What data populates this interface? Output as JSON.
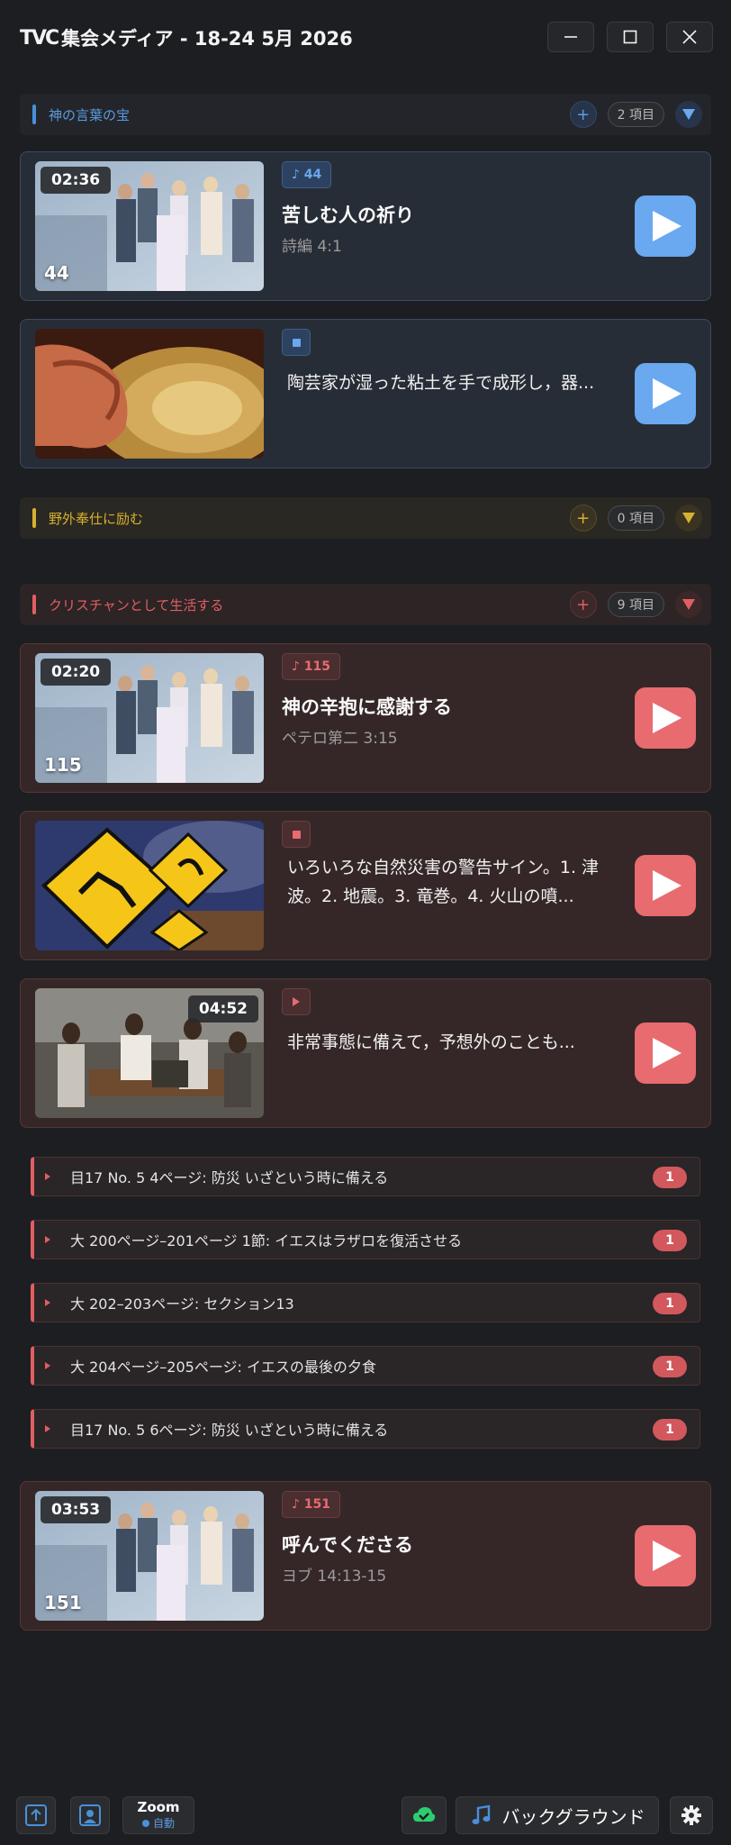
{
  "window": {
    "logo": "TVC",
    "title": "集会メディア - 18-24 5月 2026"
  },
  "sections": {
    "treasures": {
      "label": "神の言葉の宝",
      "add": "+",
      "count": "2 項目",
      "color": "#4a90d9"
    },
    "ministry": {
      "label": "野外奉仕に励む",
      "add": "+",
      "count": "0 項目",
      "color": "#d8b12e"
    },
    "living": {
      "label": "クリスチャンとして生活する",
      "add": "+",
      "count": "9 項目",
      "color": "#e15e64"
    }
  },
  "cards": [
    {
      "kind": "song",
      "duration": "02:36",
      "number": "44",
      "badge": "♪ 44",
      "title": "苦しむ人の祈り",
      "subtitle": "詩編 4:1"
    },
    {
      "kind": "image",
      "description": "陶芸家が湿った粘土を手で成形し，器..."
    },
    {
      "kind": "song",
      "duration": "02:20",
      "number": "115",
      "badge": "♪ 115",
      "title": "神の辛抱に感謝する",
      "subtitle": "ペテロ第二 3:15"
    },
    {
      "kind": "image",
      "description": "いろいろな自然災害の警告サイン。1. 津波。2. 地震。3. 竜巻。4. 火山の噴..."
    },
    {
      "kind": "video",
      "duration": "04:52",
      "description": "非常事態に備えて，予想外のことも..."
    },
    {
      "kind": "song",
      "duration": "03:53",
      "number": "151",
      "badge": "♪ 151",
      "title": "呼んでくださる",
      "subtitle": "ヨブ 14:13-15"
    }
  ],
  "references": [
    {
      "label": "目17 No. 5 4ページ: 防災 いざという時に備える",
      "count": "1"
    },
    {
      "label": "大 200ページ–201ページ 1節: イエスはラザロを復活させる",
      "count": "1"
    },
    {
      "label": "大 202–203ページ: セクション13",
      "count": "1"
    },
    {
      "label": "大 204ページ–205ページ: イエスの最後の夕食",
      "count": "1"
    },
    {
      "label": "目17 No. 5 6ページ: 防災 いざという時に備える",
      "count": "1"
    }
  ],
  "bottombar": {
    "zoom_label": "Zoom",
    "zoom_status": "自動",
    "background_label": "バックグラウンド"
  },
  "colors": {
    "accent_blue": "#6aa8ef",
    "accent_gold": "#d8b12e",
    "accent_red": "#e86b70",
    "sync_green": "#2ecc71"
  }
}
